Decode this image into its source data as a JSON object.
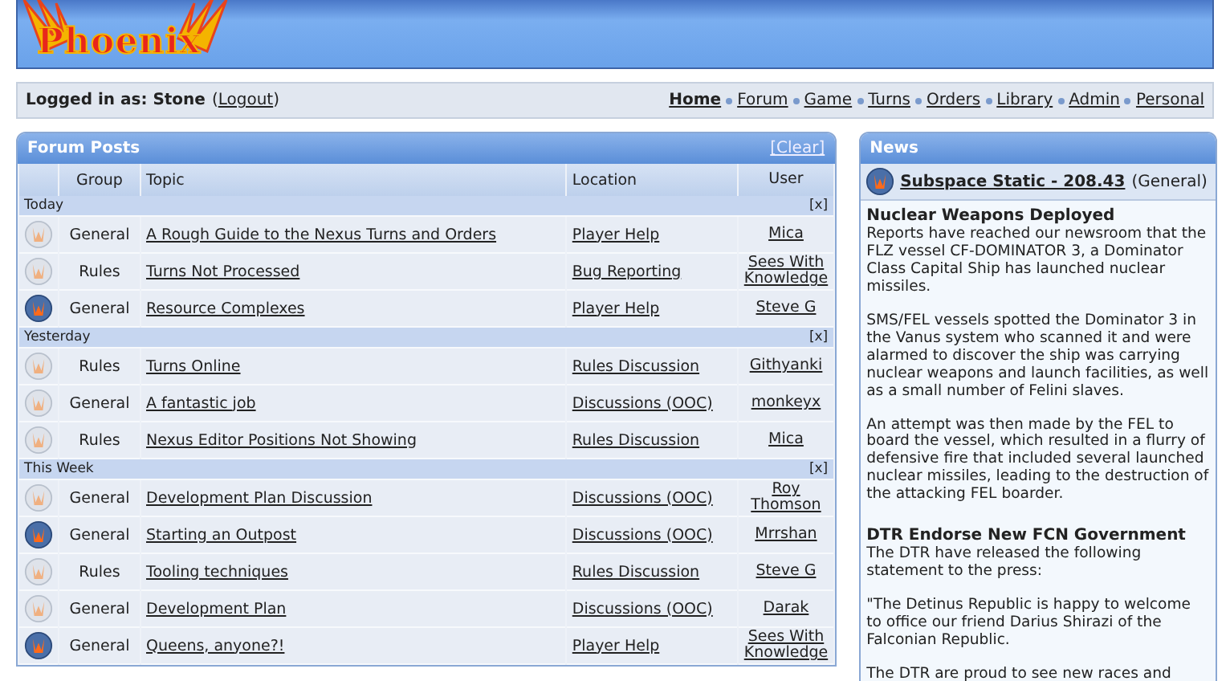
{
  "header": {
    "logo": "Phoenix"
  },
  "login_bar": {
    "label": "Logged in as: Stone",
    "logout_open": "(",
    "logout": "Logout",
    "logout_close": ")",
    "nav": [
      {
        "label": "Home",
        "selected": true
      },
      {
        "label": "Forum",
        "selected": false
      },
      {
        "label": "Game",
        "selected": false
      },
      {
        "label": "Turns",
        "selected": false
      },
      {
        "label": "Orders",
        "selected": false
      },
      {
        "label": "Library",
        "selected": false
      },
      {
        "label": "Admin",
        "selected": false
      },
      {
        "label": "Personal",
        "selected": false
      }
    ]
  },
  "forum_posts": {
    "title": "Forum Posts",
    "clear": "[Clear]",
    "columns": [
      "Group",
      "Topic",
      "Location",
      "User"
    ],
    "groups": [
      {
        "label": "Today",
        "close": "[x]",
        "rows": [
          {
            "unread": false,
            "group": "General",
            "topic": "A Rough Guide to the Nexus Turns and Orders",
            "location": "Player Help",
            "user": "Mica"
          },
          {
            "unread": false,
            "group": "Rules",
            "topic": "Turns Not Processed",
            "location": "Bug Reporting",
            "user": "Sees With Knowledge"
          },
          {
            "unread": true,
            "group": "General",
            "topic": "Resource Complexes",
            "location": "Player Help",
            "user": "Steve G"
          }
        ]
      },
      {
        "label": "Yesterday",
        "close": "[x]",
        "rows": [
          {
            "unread": false,
            "group": "Rules",
            "topic": "Turns Online",
            "location": "Rules Discussion",
            "user": "Githyanki"
          },
          {
            "unread": false,
            "group": "General",
            "topic": "A fantastic job",
            "location": "Discussions (OOC)",
            "user": "monkeyx"
          },
          {
            "unread": false,
            "group": "Rules",
            "topic": "Nexus Editor Positions Not Showing",
            "location": "Rules Discussion",
            "user": "Mica"
          }
        ]
      },
      {
        "label": "This Week",
        "close": "[x]",
        "rows": [
          {
            "unread": false,
            "group": "General",
            "topic": "Development Plan Discussion",
            "location": "Discussions (OOC)",
            "user": "Roy Thomson"
          },
          {
            "unread": true,
            "group": "General",
            "topic": "Starting an Outpost",
            "location": "Discussions (OOC)",
            "user": "Mrrshan"
          },
          {
            "unread": false,
            "group": "Rules",
            "topic": "Tooling techniques",
            "location": "Rules Discussion",
            "user": "Steve G"
          },
          {
            "unread": false,
            "group": "General",
            "topic": "Development Plan",
            "location": "Discussions (OOC)",
            "user": "Darak"
          },
          {
            "unread": true,
            "group": "General",
            "topic": "Queens, anyone?!",
            "location": "Player Help",
            "user": "Sees With Knowledge"
          }
        ]
      }
    ]
  },
  "news": {
    "title": "News",
    "headline": {
      "unread": true,
      "title": "Subspace Static - 208.43",
      "group": "(General)"
    },
    "articles": [
      {
        "title": "Nuclear Weapons Deployed",
        "paragraphs": [
          "Reports have reached our newsroom that the FLZ vessel CF-DOMINATOR 3, a Dominator Class Capital Ship has launched nuclear missiles.",
          "SMS/FEL vessels spotted the Dominator 3 in the Vanus system who scanned it and were alarmed to discover the ship was carrying nuclear weapons and launch facilities, as well as a small number of Felini slaves.",
          "An attempt was then made by the FEL to board the vessel, which resulted in a flurry of defensive fire that included several launched nuclear missiles, leading to the destruction of the attacking FEL boarder."
        ]
      },
      {
        "title": "DTR Endorse New FCN Government",
        "paragraphs": [
          "The DTR have released the following statement to the press:",
          "\"The Detinus Republic is happy to welcome to office our friend Darius Shirazi of the Falconian Republic.",
          "The DTR are proud to see new races and"
        ]
      }
    ]
  }
}
